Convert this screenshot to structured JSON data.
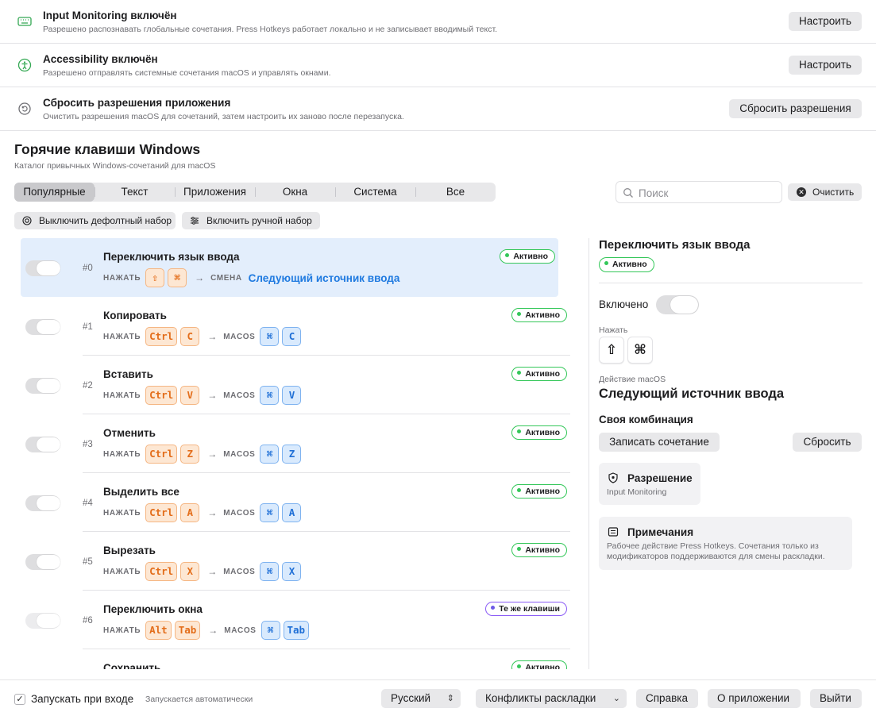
{
  "permissions": [
    {
      "title": "Input Monitoring включён",
      "desc": "Разрешено распознавать глобальные сочетания. Press Hotkeys работает локально и не записывает вводимый текст.",
      "button": "Настроить",
      "icon": "keyboard-icon"
    },
    {
      "title": "Accessibility включён",
      "desc": "Разрешено отправлять системные сочетания macOS и управлять окнами.",
      "button": "Настроить",
      "icon": "accessibility-icon"
    },
    {
      "title": "Сбросить разрешения приложения",
      "desc": "Очистить разрешения macOS для сочетаний, затем настроить их заново после перезапуска.",
      "button": "Сбросить разрешения",
      "icon": "reset-icon"
    }
  ],
  "header": {
    "title": "Горячие клавиши Windows",
    "subtitle": "Каталог привычных Windows-сочетаний для macOS"
  },
  "tabs": [
    "Популярные",
    "Текст",
    "Приложения",
    "Окна",
    "Система",
    "Все"
  ],
  "selected_tab": "Популярные",
  "search": {
    "placeholder": "Поиск",
    "value": ""
  },
  "clear_label": "Очистить",
  "chips": {
    "disable_default": "Выключить дефолтный набор",
    "enable_manual": "Включить ручной набор"
  },
  "labels": {
    "press": "НАЖАТЬ",
    "macos": "MACOS",
    "switch": "СМЕНА"
  },
  "rows": [
    {
      "index": "#0",
      "title": "Переключить язык ввода",
      "status": "Активно",
      "win_keys": [
        "⇧",
        "⌘"
      ],
      "kind": "СМЕНА",
      "target": "Следующий источник ввода",
      "mac_keys": [],
      "selected": true
    },
    {
      "index": "#1",
      "title": "Копировать",
      "status": "Активно",
      "win_keys": [
        "Ctrl",
        "C"
      ],
      "kind": "MACOS",
      "mac_keys": [
        "⌘",
        "C"
      ]
    },
    {
      "index": "#2",
      "title": "Вставить",
      "status": "Активно",
      "win_keys": [
        "Ctrl",
        "V"
      ],
      "kind": "MACOS",
      "mac_keys": [
        "⌘",
        "V"
      ]
    },
    {
      "index": "#3",
      "title": "Отменить",
      "status": "Активно",
      "win_keys": [
        "Ctrl",
        "Z"
      ],
      "kind": "MACOS",
      "mac_keys": [
        "⌘",
        "Z"
      ]
    },
    {
      "index": "#4",
      "title": "Выделить все",
      "status": "Активно",
      "win_keys": [
        "Ctrl",
        "A"
      ],
      "kind": "MACOS",
      "mac_keys": [
        "⌘",
        "A"
      ]
    },
    {
      "index": "#5",
      "title": "Вырезать",
      "status": "Активно",
      "win_keys": [
        "Ctrl",
        "X"
      ],
      "kind": "MACOS",
      "mac_keys": [
        "⌘",
        "X"
      ]
    },
    {
      "index": "#6",
      "title": "Переключить окна",
      "status": "Те же клавиши",
      "win_keys": [
        "Alt",
        "Tab"
      ],
      "kind": "MACOS",
      "mac_keys": [
        "⌘",
        "Tab"
      ],
      "toggle_off": true
    },
    {
      "index": "",
      "title": "Сохранить",
      "status": "Активно",
      "win_keys": [],
      "kind": "",
      "mac_keys": [],
      "partial": true
    }
  ],
  "detail": {
    "title": "Переключить язык ввода",
    "status": "Активно",
    "enabled_label": "Включено",
    "press_label": "Нажать",
    "keys": [
      "⇧",
      "⌘"
    ],
    "action_label": "Действие macOS",
    "action": "Следующий источник ввода",
    "own_combo": "Своя комбинация",
    "record": "Записать сочетание",
    "reset": "Сбросить",
    "permission_title": "Разрешение",
    "permission_value": "Input Monitoring",
    "notes_title": "Примечания",
    "notes_text": "Рабочее действие Press Hotkeys. Сочетания только из модификаторов поддерживаются для смены раскладки."
  },
  "footer": {
    "launch_label": "Запускать при входе",
    "launch_checked": true,
    "launch_sub": "Запускается автоматически",
    "language": "Русский",
    "conflicts": "Конфликты раскладки",
    "help": "Справка",
    "about": "О приложении",
    "quit": "Выйти"
  },
  "colors": {
    "active_green": "#34c759",
    "same_purple": "#6d5ae6",
    "win_orange": "#e36d1a",
    "mac_blue": "#1f6fd6",
    "selection": "#e3eefc",
    "link_blue": "#1f7ae0"
  }
}
